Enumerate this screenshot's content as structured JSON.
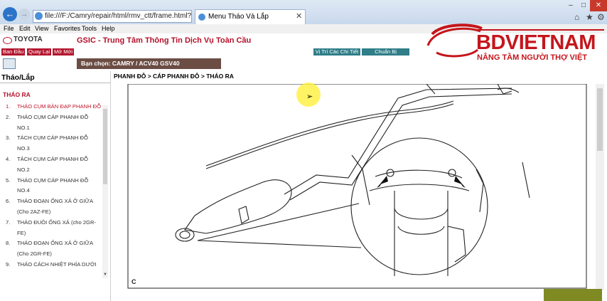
{
  "browser": {
    "address": "file:///F:/Camry/repair/html/rmv_ctt/frame.html?p",
    "tab_title": "Menu Tháo Và Lắp",
    "menus": [
      "File",
      "Edit",
      "View",
      "Favorites",
      "Tools",
      "Help"
    ]
  },
  "header": {
    "brand": "TOYOTA",
    "title": "GSIC - Trung Tâm Thông Tin Dịch Vụ Toàn Cầu",
    "nav_buttons": [
      "Ban Đầu",
      "Quay Lại",
      "Mở Mới"
    ],
    "teal_buttons": [
      "Vị Trí Các Chi Tiết",
      "Chuẩn Bị"
    ],
    "model": "Bạn chọn: CAMRY / ACV40 GSV40"
  },
  "sidebar": {
    "title": "Tháo/Lắp",
    "section": "THÁO RA",
    "items": [
      {
        "num": "1.",
        "label": "THÁO CỤM BÀN ĐẠP PHANH ĐỖ"
      },
      {
        "num": "2.",
        "label": "THÁO CỤM CÁP PHANH ĐỖ NO.1"
      },
      {
        "num": "3.",
        "label": "TÁCH CỤM CÁP PHANH ĐỖ NO.3"
      },
      {
        "num": "4.",
        "label": "TÁCH CỤM CÁP PHANH ĐỖ NO.2"
      },
      {
        "num": "5.",
        "label": "THÁO CỤM CÁP PHANH ĐỖ NO.4"
      },
      {
        "num": "6.",
        "label": "THÁO ĐOẠN ỐNG XẢ Ở GIỮA (Cho 2AZ-FE)"
      },
      {
        "num": "7.",
        "label": "THÁO ĐUÔI ỐNG XẢ (cho 2GR-FE)"
      },
      {
        "num": "8.",
        "label": "THÁO ĐOẠN ỐNG XẢ Ở GIỮA (Cho 2GR-FE)"
      },
      {
        "num": "9.",
        "label": "THÁO CÁCH NHIỆT PHÍA DƯỚI"
      }
    ]
  },
  "main": {
    "breadcrumb": "PHANH ĐỖ > CÁP PHANH ĐỖ > THÁO RA",
    "figure_label": "C"
  },
  "watermark": {
    "name": "BDVIETNAM",
    "tagline": "NÂNG TẦM NGƯỜI THỢ VIỆT"
  },
  "colors": {
    "toyota_red": "#b3102a",
    "teal": "#2f7e88",
    "model_bar": "#6b4d44"
  }
}
